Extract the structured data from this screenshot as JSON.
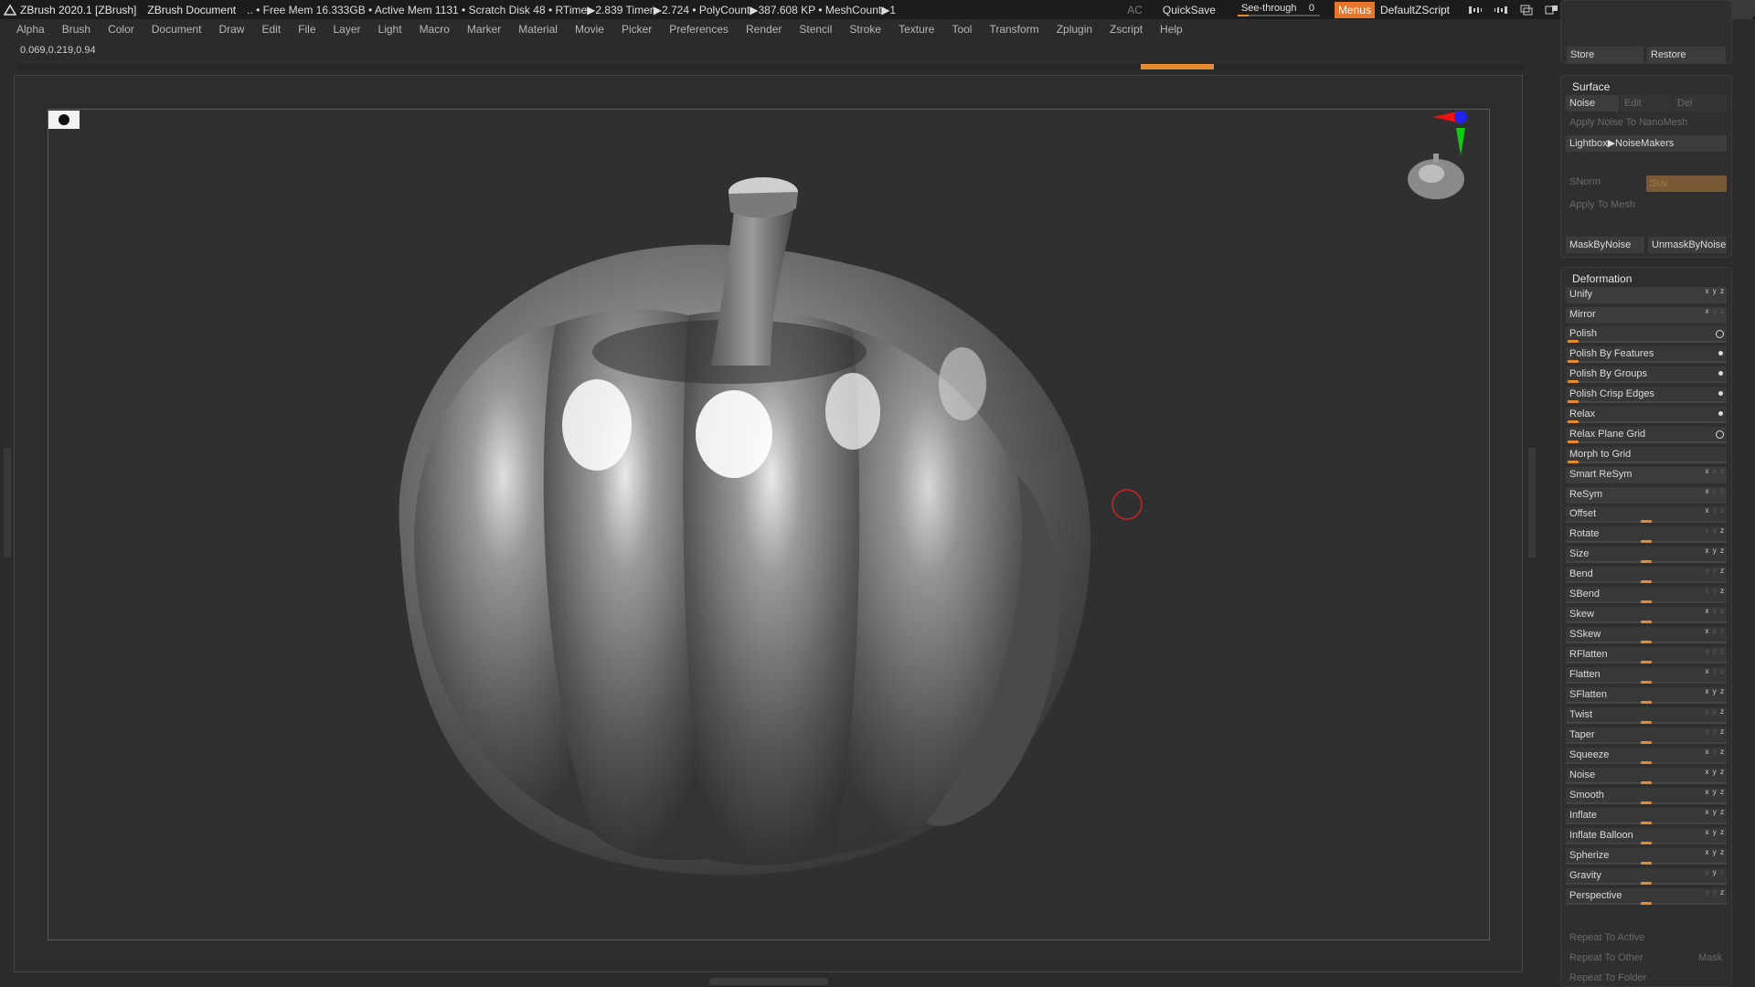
{
  "titlebar": {
    "app_title": "ZBrush 2020.1 [ZBrush]",
    "document": "ZBrush Document",
    "stats": "..  • Free Mem 16.333GB • Active Mem 1131 • Scratch Disk 48 • RTime▶2.839 Timer▶2.724 • PolyCount▶387.608 KP • MeshCount▶1",
    "ac": "AC",
    "quicksave": "QuickSave",
    "seethrough_label": "See-through",
    "seethrough_value": "0",
    "menus": "Menus",
    "default_zscript": "DefaultZScript"
  },
  "menu": [
    "Alpha",
    "Brush",
    "Color",
    "Document",
    "Draw",
    "Edit",
    "File",
    "Layer",
    "Light",
    "Macro",
    "Marker",
    "Material",
    "Movie",
    "Picker",
    "Preferences",
    "Render",
    "Stencil",
    "Stroke",
    "Texture",
    "Tool",
    "Transform",
    "Zplugin",
    "Zscript",
    "Help"
  ],
  "coords": "0.069,0.219,0.94",
  "panel": {
    "store": "Store",
    "restore": "Restore",
    "surface": {
      "title": "Surface",
      "noise": "Noise",
      "edit": "Edit",
      "del": "Del",
      "apply_nanomesh": "Apply Noise To NanoMesh",
      "lightbox": "Lightbox▶NoiseMakers",
      "snorm": "SNorm",
      "suv": "Suv",
      "apply_mesh": "Apply To Mesh",
      "mask_by_noise": "MaskByNoise",
      "unmask_by_noise": "UnmaskByNoise"
    },
    "deformation": {
      "title": "Deformation",
      "items": [
        {
          "label": "Unify"
        },
        {
          "label": "Mirror"
        },
        {
          "label": "Polish"
        },
        {
          "label": "Polish By Features"
        },
        {
          "label": "Polish By Groups"
        },
        {
          "label": "Polish Crisp Edges"
        },
        {
          "label": "Relax"
        },
        {
          "label": "Relax Plane Grid"
        },
        {
          "label": "Morph to Grid"
        },
        {
          "label": "Smart ReSym"
        },
        {
          "label": "ReSym"
        },
        {
          "label": "Offset"
        },
        {
          "label": "Rotate"
        },
        {
          "label": "Size"
        },
        {
          "label": "Bend"
        },
        {
          "label": "SBend"
        },
        {
          "label": "Skew"
        },
        {
          "label": "SSkew"
        },
        {
          "label": "RFlatten"
        },
        {
          "label": "Flatten"
        },
        {
          "label": "SFlatten"
        },
        {
          "label": "Twist"
        },
        {
          "label": "Taper"
        },
        {
          "label": "Squeeze"
        },
        {
          "label": "Noise"
        },
        {
          "label": "Smooth"
        },
        {
          "label": "Inflate"
        },
        {
          "label": "Inflate Balloon"
        },
        {
          "label": "Spherize"
        },
        {
          "label": "Gravity"
        },
        {
          "label": "Perspective"
        }
      ],
      "repeat_to_active": "Repeat To Active",
      "repeat_to_other": "Repeat To Other",
      "mask": "Mask",
      "repeat_to_folder": "Repeat To Folder"
    }
  },
  "colors": {
    "accent": "#e88a2e",
    "background": "#2b2b2b"
  },
  "icons": [
    "zbrush-logo-icon",
    "record-icon",
    "axis-gizmo-icon",
    "navigation-mesh-icon",
    "brush-cursor-icon"
  ]
}
